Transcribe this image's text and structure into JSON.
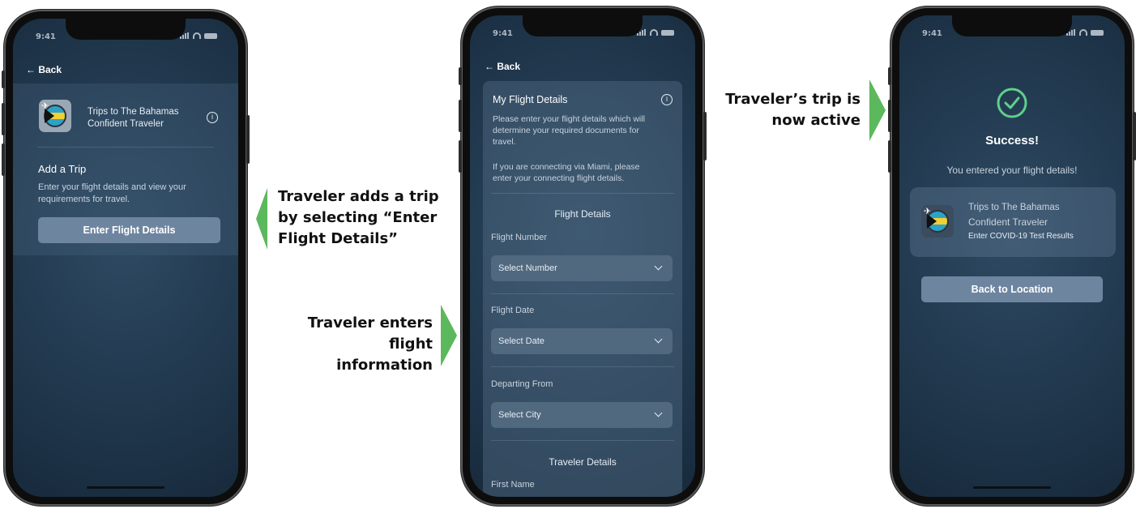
{
  "status_bar": {
    "time": "9:41"
  },
  "screen1": {
    "back_label": "← Back",
    "card_title": "Trips to The Bahamas",
    "card_subtitle": "Confident Traveler",
    "info_symbol": "i",
    "section_title": "Add a Trip",
    "section_body_line1": "Enter your flight details and view your",
    "section_body_line2": "requirements for travel.",
    "button_label": "Enter Flight Details"
  },
  "screen2": {
    "back_label": "← Back",
    "panel_title": "My Flight Details",
    "info_symbol": "i",
    "intro_line1": "Please enter your flight details which will",
    "intro_line2": "determine your required documents for",
    "intro_line3": "travel.",
    "connect_line1": "If you are connecting via Miami, please",
    "connect_line2": "enter your connecting flight details.",
    "flight_section_title": "Flight Details",
    "fields": [
      {
        "label": "Flight Number",
        "placeholder": "Select Number"
      },
      {
        "label": "Flight Date",
        "placeholder": "Select Date"
      },
      {
        "label": "Departing From",
        "placeholder": "Select City"
      }
    ],
    "traveler_section_title": "Traveler Details",
    "first_name_label": "First Name"
  },
  "screen3": {
    "success_title": "Success!",
    "success_message": "You entered your flight details!",
    "card_title": "Trips to The Bahamas",
    "card_subtitle": "Confident Traveler",
    "card_status": "Enter COVID-19 Test Results",
    "button_label": "Back to Location"
  },
  "captions": {
    "step1_line1": "Traveler adds a trip",
    "step1_line2": "by selecting “Enter",
    "step1_line3": "Flight Details”",
    "step2_line1": "Traveler enters",
    "step2_line2": "flight information",
    "step3_line1": "Traveler’s trip is",
    "step3_line2": "now active"
  },
  "colors": {
    "arrow_green": "#5cb85c",
    "button_blue": "#6e85a0",
    "success_green": "#5ed08a"
  },
  "icons": [
    "back-arrow-icon",
    "info-icon",
    "bahamas-flag-icon",
    "chevron-down-icon",
    "checkmark-circle-icon"
  ]
}
